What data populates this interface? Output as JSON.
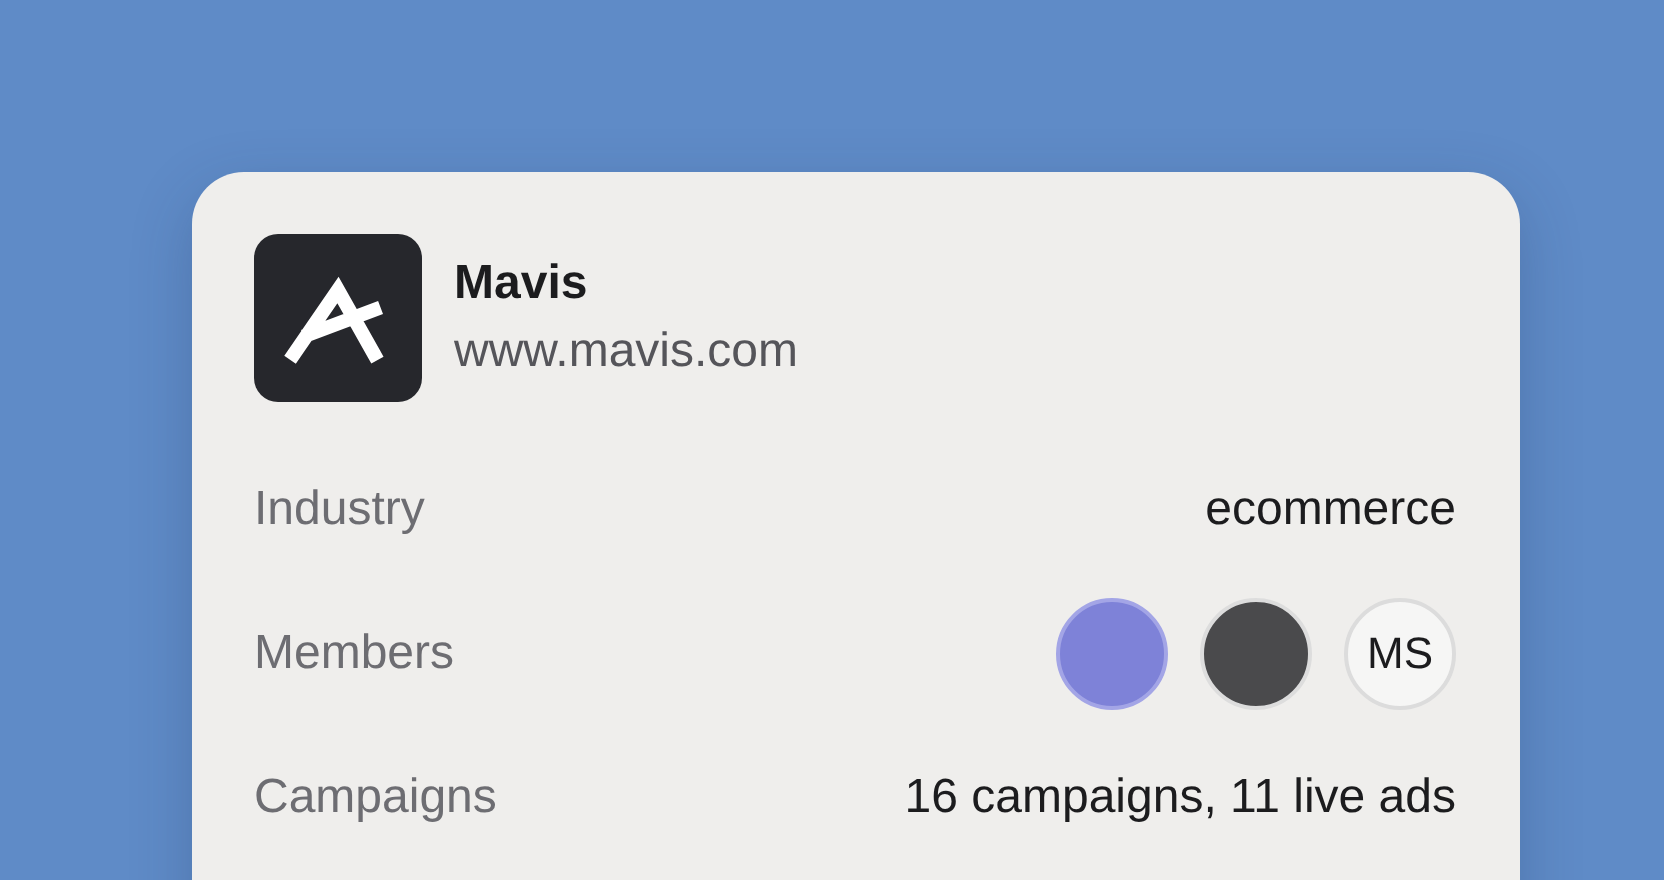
{
  "company": {
    "name": "Mavis",
    "website": "www.mavis.com"
  },
  "details": [
    {
      "kind": "text",
      "label": "Industry",
      "value": "ecommerce"
    },
    {
      "kind": "members",
      "label": "Members",
      "members": [
        {
          "kind": "photo"
        },
        {
          "kind": "photo"
        },
        {
          "kind": "initials",
          "initials": "MS"
        }
      ]
    },
    {
      "kind": "text",
      "label": "Campaigns",
      "value": "16 campaigns, 11 live ads"
    }
  ]
}
